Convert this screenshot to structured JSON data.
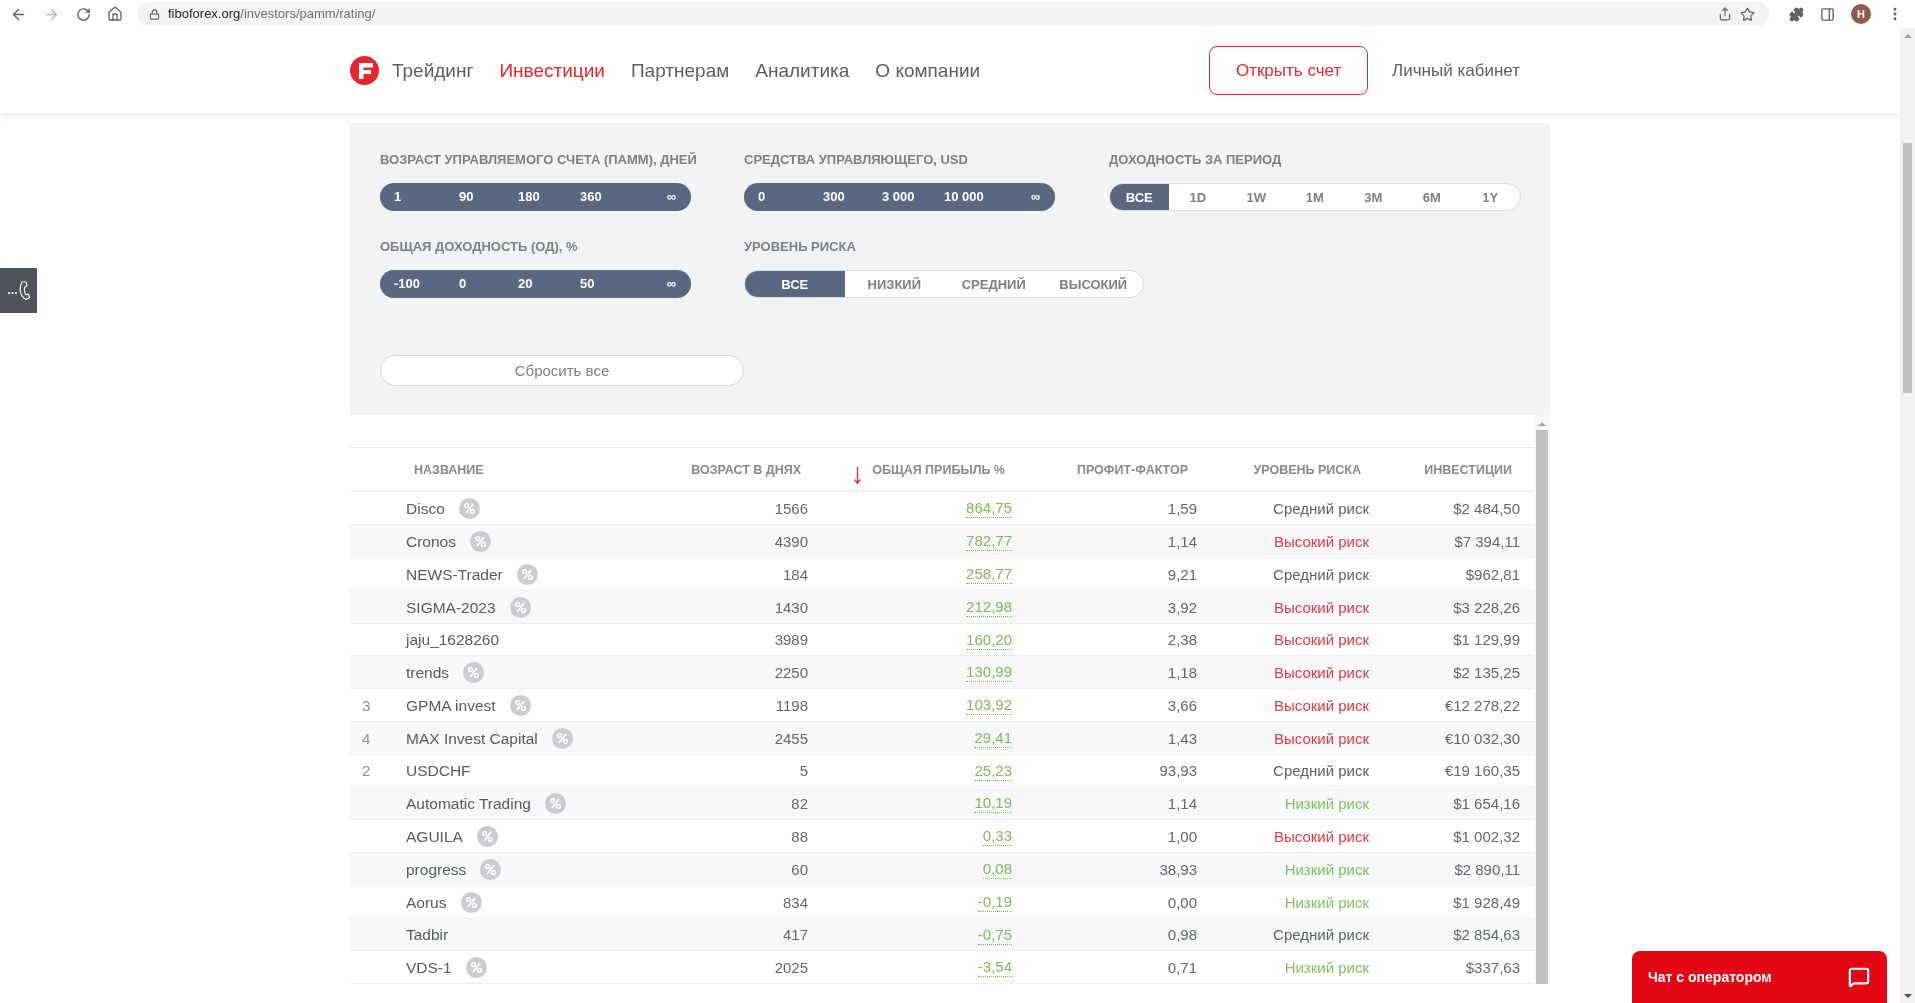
{
  "browser": {
    "url": {
      "host": "fiboforex.org",
      "path": "/investors/pamm/rating/"
    },
    "profile_initial": "H"
  },
  "header": {
    "nav": [
      {
        "label": "Трейдинг",
        "selected": false
      },
      {
        "label": "Инвестиции",
        "selected": true
      },
      {
        "label": "Партнерам",
        "selected": false
      },
      {
        "label": "Аналитика",
        "selected": false
      },
      {
        "label": "О компании",
        "selected": false
      }
    ],
    "open_account_button": "Открыть счет",
    "cabinet_link": "Личный кабинет"
  },
  "filters": [
    {
      "kind": "range",
      "label": "ВОЗРАСТ УПРАВЛЯЕМОГО СЧЕТА (ПАММ), ДНЕЙ",
      "ticks": [
        "1",
        "90",
        "180",
        "360",
        "∞"
      ],
      "level": 1
    },
    {
      "kind": "range",
      "label": "СРЕДСТВА УПРАВЛЯЮЩЕГО, USD",
      "ticks": [
        "0",
        "300",
        "3 000",
        "10 000",
        "∞"
      ],
      "level": 1
    },
    {
      "kind": "segmented",
      "label": "ДОХОДНОСТЬ ЗА ПЕРИОД",
      "options": [
        {
          "label": "ВСЕ",
          "selected": true
        },
        {
          "label": "1D",
          "selected": false
        },
        {
          "label": "1W",
          "selected": false
        },
        {
          "label": "1M",
          "selected": false
        },
        {
          "label": "3M",
          "selected": false
        },
        {
          "label": "6M",
          "selected": false
        },
        {
          "label": "1Y",
          "selected": false
        }
      ]
    },
    {
      "kind": "range",
      "label": "ОБЩАЯ ДОХОДНОСТЬ (ОД), %",
      "ticks": [
        "-100",
        "0",
        "20",
        "50",
        "∞"
      ],
      "level": 1
    },
    {
      "kind": "segmented",
      "label": "УРОВЕНЬ РИСКА",
      "options": [
        {
          "label": "ВСЕ",
          "selected": true
        },
        {
          "label": "НИЗКИЙ",
          "selected": false
        },
        {
          "label": "СРЕДНИЙ",
          "selected": false
        },
        {
          "label": "ВЫСОКИЙ",
          "selected": false
        }
      ]
    }
  ],
  "reset_button": "Сбросить все",
  "table": {
    "columns": [
      {
        "label": "НАЗВАНИЕ",
        "sorted": false
      },
      {
        "label": "ВОЗРАСТ В ДНЯХ",
        "sorted": false
      },
      {
        "label": "ОБЩАЯ ПРИБЫЛЬ %",
        "sorted": true
      },
      {
        "label": "ПРОФИТ-ФАКТОР",
        "sorted": false
      },
      {
        "label": "УРОВЕНЬ РИСКА",
        "sorted": false
      },
      {
        "label": "ИНВЕСТИЦИИ",
        "sorted": false
      }
    ],
    "rows": [
      {
        "name": "Disco",
        "percent_icon": true,
        "age": "1566",
        "profit": "864,75",
        "profit_factor": "1,59",
        "risk": {
          "text": "Средний риск",
          "kind": "medium"
        },
        "investments": "$2 484,50"
      },
      {
        "name": "Cronos",
        "percent_icon": true,
        "age": "4390",
        "profit": "782,77",
        "profit_factor": "1,14",
        "risk": {
          "text": "Высокий риск",
          "kind": "high"
        },
        "investments": "$7 394,11"
      },
      {
        "name": "NEWS-Trader",
        "percent_icon": true,
        "age": "184",
        "profit": "258,77",
        "profit_factor": "9,21",
        "risk": {
          "text": "Средний риск",
          "kind": "medium"
        },
        "investments": "$962,81"
      },
      {
        "name": "SIGMA-2023",
        "percent_icon": true,
        "age": "1430",
        "profit": "212,98",
        "profit_factor": "3,92",
        "risk": {
          "text": "Высокий риск",
          "kind": "high"
        },
        "investments": "$3 228,26"
      },
      {
        "name": "jaju_1628260",
        "percent_icon": false,
        "age": "3989",
        "profit": "160,20",
        "profit_factor": "2,38",
        "risk": {
          "text": "Высокий риск",
          "kind": "high"
        },
        "investments": "$1 129,99"
      },
      {
        "name": "trends",
        "percent_icon": true,
        "age": "2250",
        "profit": "130,99",
        "profit_factor": "1,18",
        "risk": {
          "text": "Высокий риск",
          "kind": "high"
        },
        "investments": "$2 135,25"
      },
      {
        "rank": "3",
        "name": "GPMA invest",
        "percent_icon": true,
        "age": "1198",
        "profit": "103,92",
        "profit_factor": "3,66",
        "risk": {
          "text": "Высокий риск",
          "kind": "high"
        },
        "investments": "€12 278,22"
      },
      {
        "rank": "4",
        "name": "MAX Invest Capital",
        "percent_icon": true,
        "age": "2455",
        "profit": "29,41",
        "profit_factor": "1,43",
        "risk": {
          "text": "Высокий риск",
          "kind": "high"
        },
        "investments": "€10 032,30"
      },
      {
        "rank": "2",
        "name": "USDCHF",
        "percent_icon": false,
        "age": "5",
        "profit": "25,23",
        "profit_factor": "93,93",
        "risk": {
          "text": "Средний риск",
          "kind": "medium"
        },
        "investments": "€19 160,35"
      },
      {
        "name": "Automatic Trading",
        "percent_icon": true,
        "age": "82",
        "profit": "10,19",
        "profit_factor": "1,14",
        "risk": {
          "text": "Низкий риск",
          "kind": "low"
        },
        "investments": "$1 654,16"
      },
      {
        "name": "AGUILA",
        "percent_icon": true,
        "age": "88",
        "profit": "0,33",
        "profit_factor": "1,00",
        "risk": {
          "text": "Высокий риск",
          "kind": "high"
        },
        "investments": "$1 002,32"
      },
      {
        "name": "progress",
        "percent_icon": true,
        "age": "60",
        "profit": "0,08",
        "profit_factor": "38,93",
        "risk": {
          "text": "Низкий риск",
          "kind": "low"
        },
        "investments": "$2 890,11"
      },
      {
        "name": "Aorus",
        "percent_icon": true,
        "age": "834",
        "profit": "-0,19",
        "profit_factor": "0,00",
        "risk": {
          "text": "Низкий риск",
          "kind": "low"
        },
        "investments": "$1 928,49"
      },
      {
        "name": "Tadbir",
        "percent_icon": false,
        "age": "417",
        "profit": "-0,75",
        "profit_factor": "0,98",
        "risk": {
          "text": "Средний риск",
          "kind": "medium"
        },
        "investments": "$2 854,63"
      },
      {
        "name": "VDS-1",
        "percent_icon": true,
        "age": "2025",
        "profit": "-3,54",
        "profit_factor": "0,71",
        "risk": {
          "text": "Низкий риск",
          "kind": "low"
        },
        "investments": "$337,63"
      }
    ]
  },
  "chat_widget": {
    "label": "Чат с оператором"
  }
}
